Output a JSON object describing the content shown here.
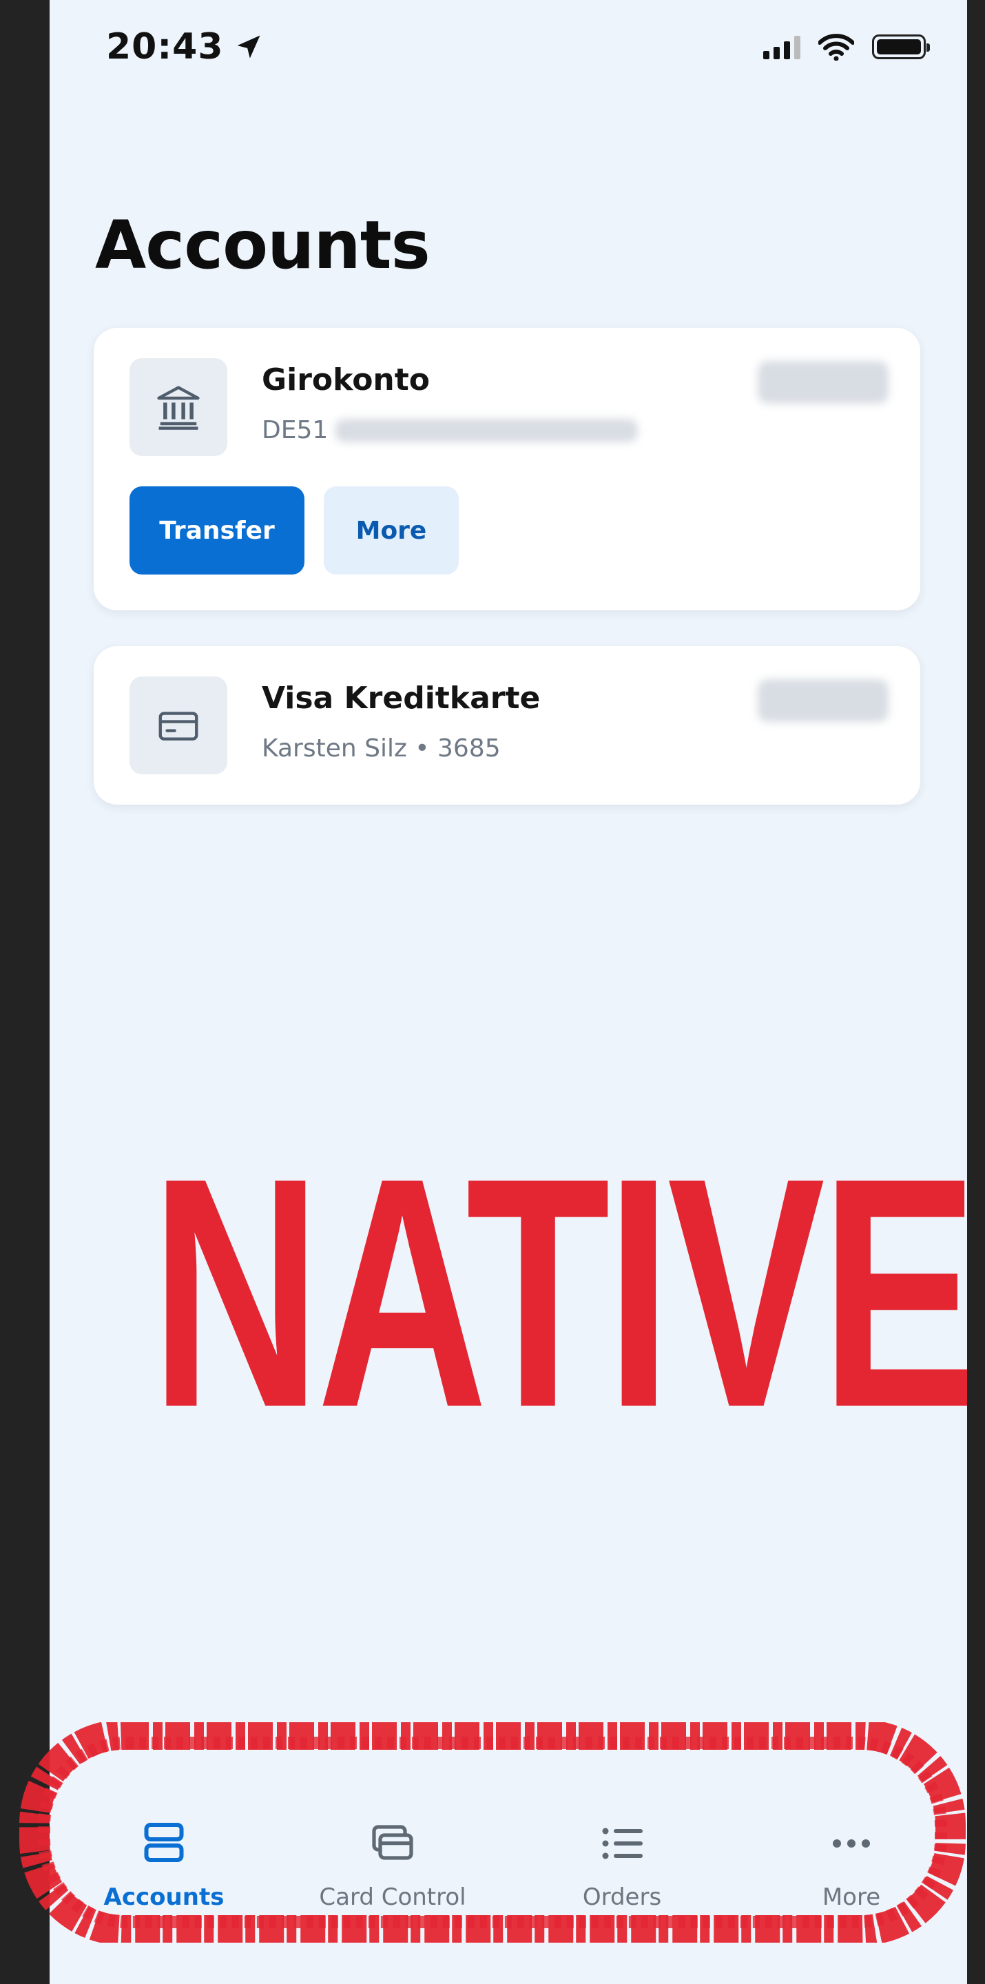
{
  "status_bar": {
    "time": "20:43"
  },
  "page": {
    "title": "Accounts"
  },
  "accounts": [
    {
      "name": "Girokonto",
      "iban_prefix": "DE51",
      "icon": "bank-icon",
      "actions": {
        "transfer": "Transfer",
        "more": "More"
      }
    },
    {
      "name": "Visa Kreditkarte",
      "detail": "Karsten Silz • 3685",
      "icon": "credit-card-icon"
    }
  ],
  "overlay": {
    "text": "NATIVE",
    "color": "#e32632"
  },
  "tab_bar": {
    "items": [
      {
        "label": "Accounts",
        "icon": "accounts-icon",
        "active": true
      },
      {
        "label": "Card Control",
        "icon": "card-control-icon",
        "active": false
      },
      {
        "label": "Orders",
        "icon": "list-icon",
        "active": false
      },
      {
        "label": "More",
        "icon": "more-dots-icon",
        "active": false
      }
    ]
  },
  "colors": {
    "accent": "#0a6fd2",
    "background": "#eef4fb",
    "annotation": "#e32632"
  }
}
